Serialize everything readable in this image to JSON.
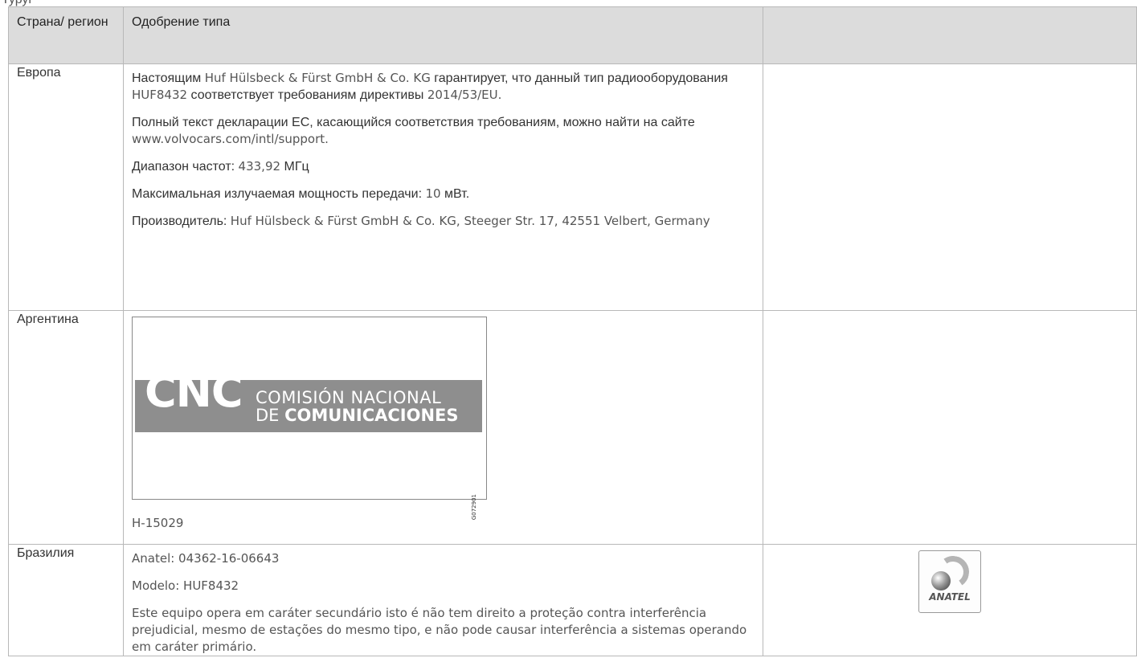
{
  "page": {
    "clipped_heading": "Туруг"
  },
  "headers": {
    "country": "Страна/ регион",
    "approval": "Одобрение типа",
    "marking": ""
  },
  "europe": {
    "country": "Европа",
    "p1": {
      "a": "Настоящим ",
      "b": "Huf Hülsbeck & Fürst GmbH & Co. KG",
      "c": " гарантирует, что данный тип радиооборудования ",
      "d": "HUF8432",
      "e": " соответствует требованиям директивы ",
      "f": "2014/53/EU",
      "g": "."
    },
    "p2": {
      "a": "Полный текст декларации ЕС, касающийся соответствия требованиям, можно найти на сайте ",
      "b": "www.volvocars.com/intl/support",
      "c": "."
    },
    "p3": {
      "a": "Диапазон частот: ",
      "b": "433,92",
      "c": " МГц"
    },
    "p4": {
      "a": "Максимальная излучаемая мощность передачи: ",
      "b": "10",
      "c": " мВт."
    },
    "p5": {
      "a": "Производитель: ",
      "b": "Huf Hülsbeck & Fürst GmbH & Co. KG, Steeger Str. 17, 42551 Velbert, Germany"
    }
  },
  "argentina": {
    "country": "Аргентина",
    "logo": {
      "letters": "CNC",
      "line1": "COMISIÓN NACIONAL",
      "line2_a": "DE ",
      "line2_b": "COMUNICACIONES",
      "code": "G072901"
    },
    "code": "H-15029"
  },
  "brazil": {
    "country": "Бразилия",
    "p1": "Anatel: 04362-16-06643",
    "p2": "Modelo: HUF8432",
    "p3": "Este equipo opera em caráter secundário isto é não tem direito a proteção contra interferência prejudicial, mesmo de estações do mesmo tipo, e não pode causar interferência a sistemas operando em caráter primário.",
    "logo_text": "ANATEL"
  }
}
